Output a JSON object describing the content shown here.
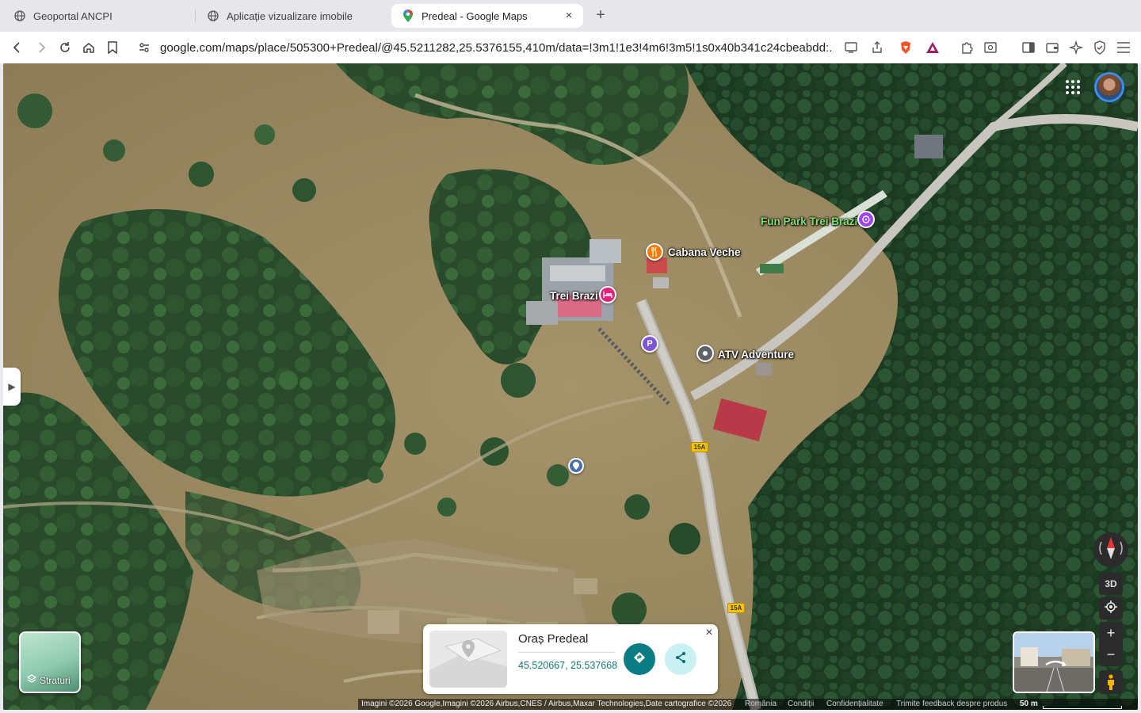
{
  "browser": {
    "tabs": [
      {
        "title": "Geoportal ANCPI",
        "active": false
      },
      {
        "title": "Aplicație vizualizare imobile",
        "active": false
      },
      {
        "title": "Predeal - Google Maps",
        "active": true
      }
    ],
    "new_tab": "+",
    "tab_close": "×",
    "url": "google.com/maps/place/505300+Predeal/@45.5211282,25.5376155,410m/data=!3m1!1e3!4m6!3m5!1s0x40b341c24cbeabdd:..."
  },
  "map": {
    "pois": [
      {
        "label": "Fun Park Trei Brazi",
        "icon": "amusement-icon",
        "color": "#a142f4"
      },
      {
        "label": "Cabana Veche",
        "icon": "restaurant-icon",
        "color": "#f07c00"
      },
      {
        "label": "Trei Brazi",
        "icon": "hotel-icon",
        "color": "#e0237d"
      },
      {
        "label": "ATV Adventure",
        "icon": "place-icon",
        "color": "#5f6368"
      }
    ],
    "parking_label": "P",
    "road_badges": [
      "15A",
      "15A"
    ],
    "layers_label": "Straturi",
    "controls": {
      "three_d": "3D",
      "zoom_in": "+",
      "zoom_out": "−"
    }
  },
  "place_card": {
    "title": "Oraș Predeal",
    "coords": "45.520667, 25.537668",
    "close": "×"
  },
  "footer": {
    "imagery": "Imagini ©2026 Google,Imagini ©2026 Airbus,CNES / Airbus,Maxar Technologies,Date cartografice ©2026",
    "country": "România",
    "terms": "Condiții",
    "privacy": "Confidențialitate",
    "feedback": "Trimite feedback despre produs",
    "scale": "50 m"
  }
}
